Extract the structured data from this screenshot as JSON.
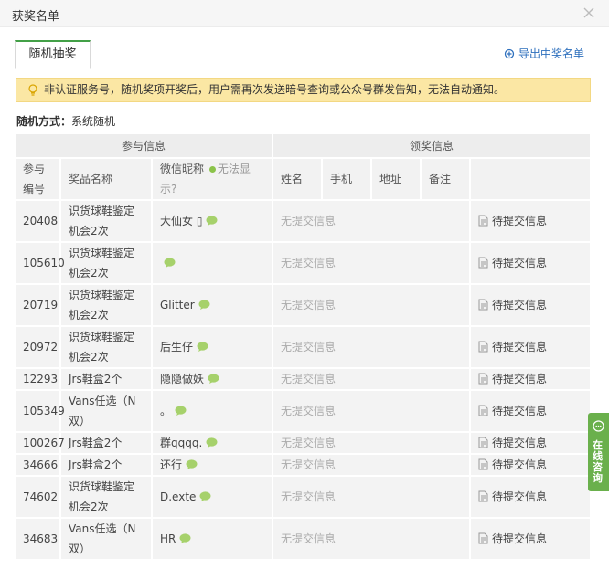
{
  "window": {
    "title": "获奖名单"
  },
  "tabs": [
    {
      "label": "随机抽奖"
    }
  ],
  "toolbar": {
    "export_label": "导出中奖名单"
  },
  "notice": {
    "text": "非认证服务号，随机奖项开奖后，用户需再次发送暗号查询或公众号群发告知，无法自动通知。"
  },
  "mode": {
    "label": "随机方式：",
    "value": "系统随机"
  },
  "table": {
    "group_headers": [
      "参与信息",
      "领奖信息"
    ],
    "columns": [
      "参与编号",
      "奖品名称",
      "微信昵称",
      "无法显示?",
      "姓名",
      "手机",
      "地址",
      "备注",
      ""
    ],
    "empty_text": "无提交信息",
    "pending_text": "待提交信息",
    "rows": [
      {
        "id": "20408",
        "prize": "识货球鞋鉴定机会2次",
        "nick": "大仙女 ▯"
      },
      {
        "id": "105610",
        "prize": "识货球鞋鉴定机会2次",
        "nick": ""
      },
      {
        "id": "20719",
        "prize": "识货球鞋鉴定机会2次",
        "nick": "Glitter"
      },
      {
        "id": "20972",
        "prize": "识货球鞋鉴定机会2次",
        "nick": "后生仔"
      },
      {
        "id": "12293",
        "prize": "Jrs鞋盒2个",
        "nick": "隐隐做妖"
      },
      {
        "id": "105349",
        "prize": "Vans任选（N双）",
        "nick": "。"
      },
      {
        "id": "100267",
        "prize": "Jrs鞋盒2个",
        "nick": "群qqqq."
      },
      {
        "id": "34666",
        "prize": "Jrs鞋盒2个",
        "nick": "还行"
      },
      {
        "id": "74602",
        "prize": "识货球鞋鉴定机会2次",
        "nick": "D.exte"
      },
      {
        "id": "34683",
        "prize": "Vans任选（N双）",
        "nick": "HR"
      }
    ]
  },
  "side_tab": {
    "label": "在线咨询"
  },
  "colors": {
    "accent_green": "#43a047",
    "notice_bg": "#fbe7a4",
    "link_blue": "#2d6fbd",
    "side_green": "#6ab04c"
  },
  "icons": [
    "close-icon",
    "export-icon",
    "bulb-icon",
    "wechat-bubble-icon",
    "document-icon",
    "chat-icon"
  ]
}
